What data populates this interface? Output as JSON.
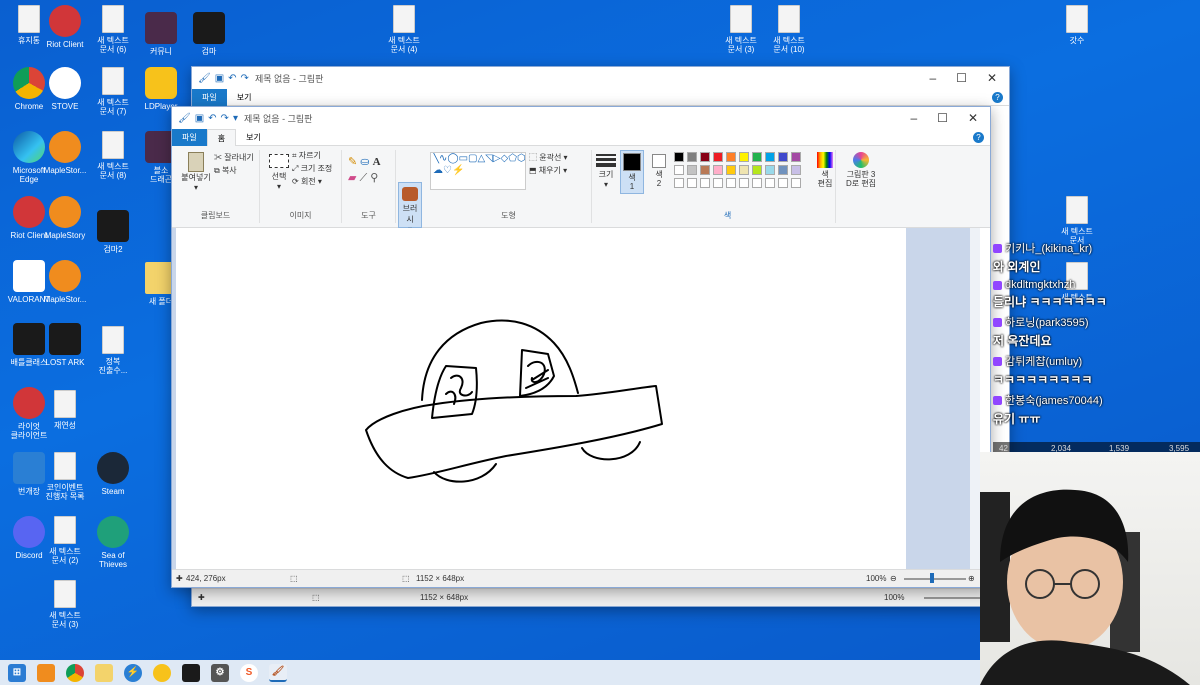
{
  "desktop": {
    "icons": [
      {
        "label": "휴지통",
        "type": "file"
      },
      {
        "label": "Riot Client",
        "type": "riot"
      },
      {
        "label": "새 텍스트\n문서 (6)",
        "type": "file"
      },
      {
        "label": "커뮤니",
        "type": "game"
      },
      {
        "label": "검마",
        "type": "dark"
      },
      {
        "label": "새 텍스트\n문서 (4)",
        "type": "file"
      },
      {
        "label": "새 텍스트\n문서 (3)",
        "type": "file"
      },
      {
        "label": "새 텍스트\n문서 (10)",
        "type": "file"
      },
      {
        "label": "갓수",
        "type": "file"
      },
      {
        "label": "Chrome",
        "type": "chrome"
      },
      {
        "label": "STOVE",
        "type": "stove"
      },
      {
        "label": "새 텍스트\n문서 (7)",
        "type": "file"
      },
      {
        "label": "LDPlayer",
        "type": "ld"
      },
      {
        "label": "Microsoft\nEdge",
        "type": "edge"
      },
      {
        "label": "MapleStor...",
        "type": "maple"
      },
      {
        "label": "새 텍스트\n문서 (8)",
        "type": "file"
      },
      {
        "label": "블소\n드래곤",
        "type": "game"
      },
      {
        "label": "Riot Client",
        "type": "riot"
      },
      {
        "label": "MapleStory",
        "type": "maple"
      },
      {
        "label": "검마2",
        "type": "dark"
      },
      {
        "label": "VALORANT",
        "type": "valorant"
      },
      {
        "label": "MapleStor...",
        "type": "maple"
      },
      {
        "label": "새 폴더",
        "type": "folder"
      },
      {
        "label": "배틀클래스",
        "type": "dark"
      },
      {
        "label": "LOST ARK",
        "type": "dark"
      },
      {
        "label": "정복\n진출수...",
        "type": "file"
      },
      {
        "label": "라이엇\n클라이언트",
        "type": "riot"
      },
      {
        "label": "재연성",
        "type": "file"
      },
      {
        "label": "번개장",
        "type": "bolt"
      },
      {
        "label": "코인이벤트\n진행자 목록",
        "type": "file"
      },
      {
        "label": "Steam",
        "type": "steam"
      },
      {
        "label": "Discord",
        "type": "discord"
      },
      {
        "label": "새 텍스트\n문서 (2)",
        "type": "file"
      },
      {
        "label": "Sea of\nThieves",
        "type": "sot"
      },
      {
        "label": "새 텍스트\n문서 (3)",
        "type": "file"
      },
      {
        "label": "새 텍스트\n문서",
        "type": "file"
      },
      {
        "label": "새 텍스트",
        "type": "file"
      }
    ]
  },
  "back_window": {
    "title": "제목 없음 - 그림판",
    "menu": [
      "파일",
      "보기"
    ],
    "status_size": "1152 × 648px",
    "zoom": "100%"
  },
  "paint": {
    "title": "제목 없음 - 그림판",
    "menu": {
      "file": "파일",
      "home": "홈",
      "view": "보기"
    },
    "clipboard": {
      "paste": "붙여넣기",
      "cut": "잘라내기",
      "copy": "복사",
      "label": "클립보드"
    },
    "image": {
      "select": "선택",
      "crop": "자르기",
      "resize": "크기 조정",
      "rotate": "회전",
      "label": "이미지"
    },
    "tools": {
      "label": "도구"
    },
    "brush": {
      "label": "브러시"
    },
    "shapes": {
      "outline": "윤곽선",
      "fill": "채우기",
      "label": "도형"
    },
    "size": {
      "label": "크기"
    },
    "colors": {
      "color1": "색\n1",
      "color2": "색\n2",
      "edit": "색\n편집",
      "paint3d": "그림판 3\nD로 편집",
      "label": "색",
      "palette_row1": [
        "#000000",
        "#7f7f7f",
        "#880015",
        "#ed1c24",
        "#ff7f27",
        "#fff200",
        "#22b14c",
        "#00a2e8",
        "#3f48cc",
        "#a349a4"
      ],
      "palette_row2": [
        "#ffffff",
        "#c3c3c3",
        "#b97a57",
        "#ffaec9",
        "#ffc90e",
        "#efe4b0",
        "#b5e61d",
        "#99d9ea",
        "#7092be",
        "#c8bfe7"
      ]
    },
    "status": {
      "cursor": "424, 276px",
      "size": "1152 × 648px",
      "zoom": "100%"
    }
  },
  "chat": [
    {
      "user": "키키나_(kikina_kr)",
      "msg": "와 외계인"
    },
    {
      "user": "dkdltmgktxhzh",
      "msg": "들리냐 ㅋㅋㅋㅋㅋㅋㅋ"
    },
    {
      "user": "하로닝(park3595)",
      "msg": "저 옥잔데요"
    },
    {
      "user": "감튀케챱(umluy)",
      "msg": "ㅋㅋㅋㅋㅋㅋㅋㅋㅋ"
    },
    {
      "user": "한봉숙(james70044)",
      "msg": "유기 ㅠㅠ"
    }
  ],
  "stream_stats": {
    "a": "42",
    "b": "2,034",
    "c": "1,539",
    "d": "3,595"
  }
}
